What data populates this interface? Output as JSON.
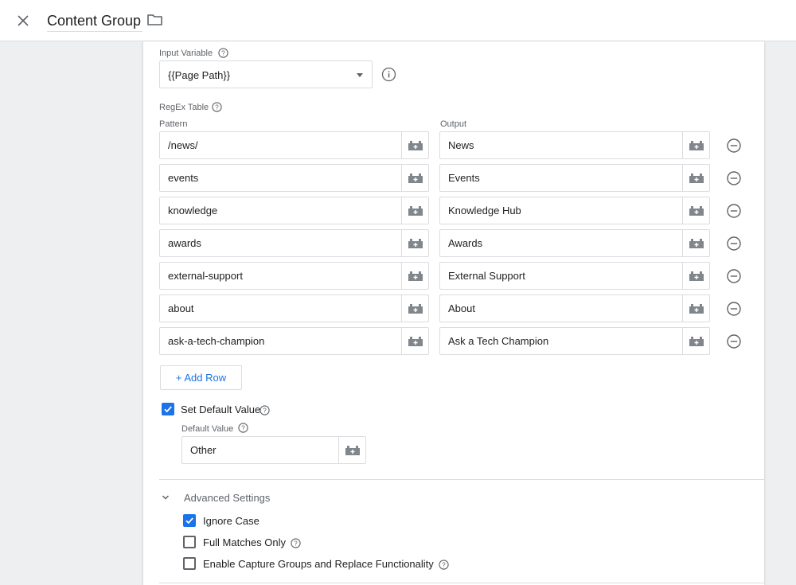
{
  "header": {
    "title": "Content Group",
    "close_icon": "close-icon",
    "folder_icon": "folder-icon"
  },
  "input_variable": {
    "label": "Input Variable",
    "value": "{{Page Path}}"
  },
  "regex_table": {
    "label": "RegEx Table",
    "pattern_header": "Pattern",
    "output_header": "Output",
    "rows": [
      {
        "pattern": "/news/",
        "output": "News"
      },
      {
        "pattern": "events",
        "output": "Events"
      },
      {
        "pattern": "knowledge",
        "output": "Knowledge Hub"
      },
      {
        "pattern": "awards",
        "output": "Awards"
      },
      {
        "pattern": "external-support",
        "output": "External Support"
      },
      {
        "pattern": "about",
        "output": "About"
      },
      {
        "pattern": "ask-a-tech-champion",
        "output": "Ask a Tech Champion"
      }
    ],
    "add_row_label": "+ Add Row"
  },
  "default_value": {
    "checkbox_label": "Set Default Value",
    "checked": true,
    "field_label": "Default Value",
    "value": "Other"
  },
  "advanced_settings": {
    "label": "Advanced Settings",
    "options": [
      {
        "label": "Ignore Case",
        "checked": true,
        "help": false
      },
      {
        "label": "Full Matches Only",
        "checked": false,
        "help": true
      },
      {
        "label": "Enable Capture Groups and Replace Functionality",
        "checked": false,
        "help": true
      }
    ]
  },
  "colors": {
    "accent": "#1a73e8",
    "border": "#dadce0",
    "muted_text": "#5f6368",
    "page_background": "#eeeff1"
  }
}
